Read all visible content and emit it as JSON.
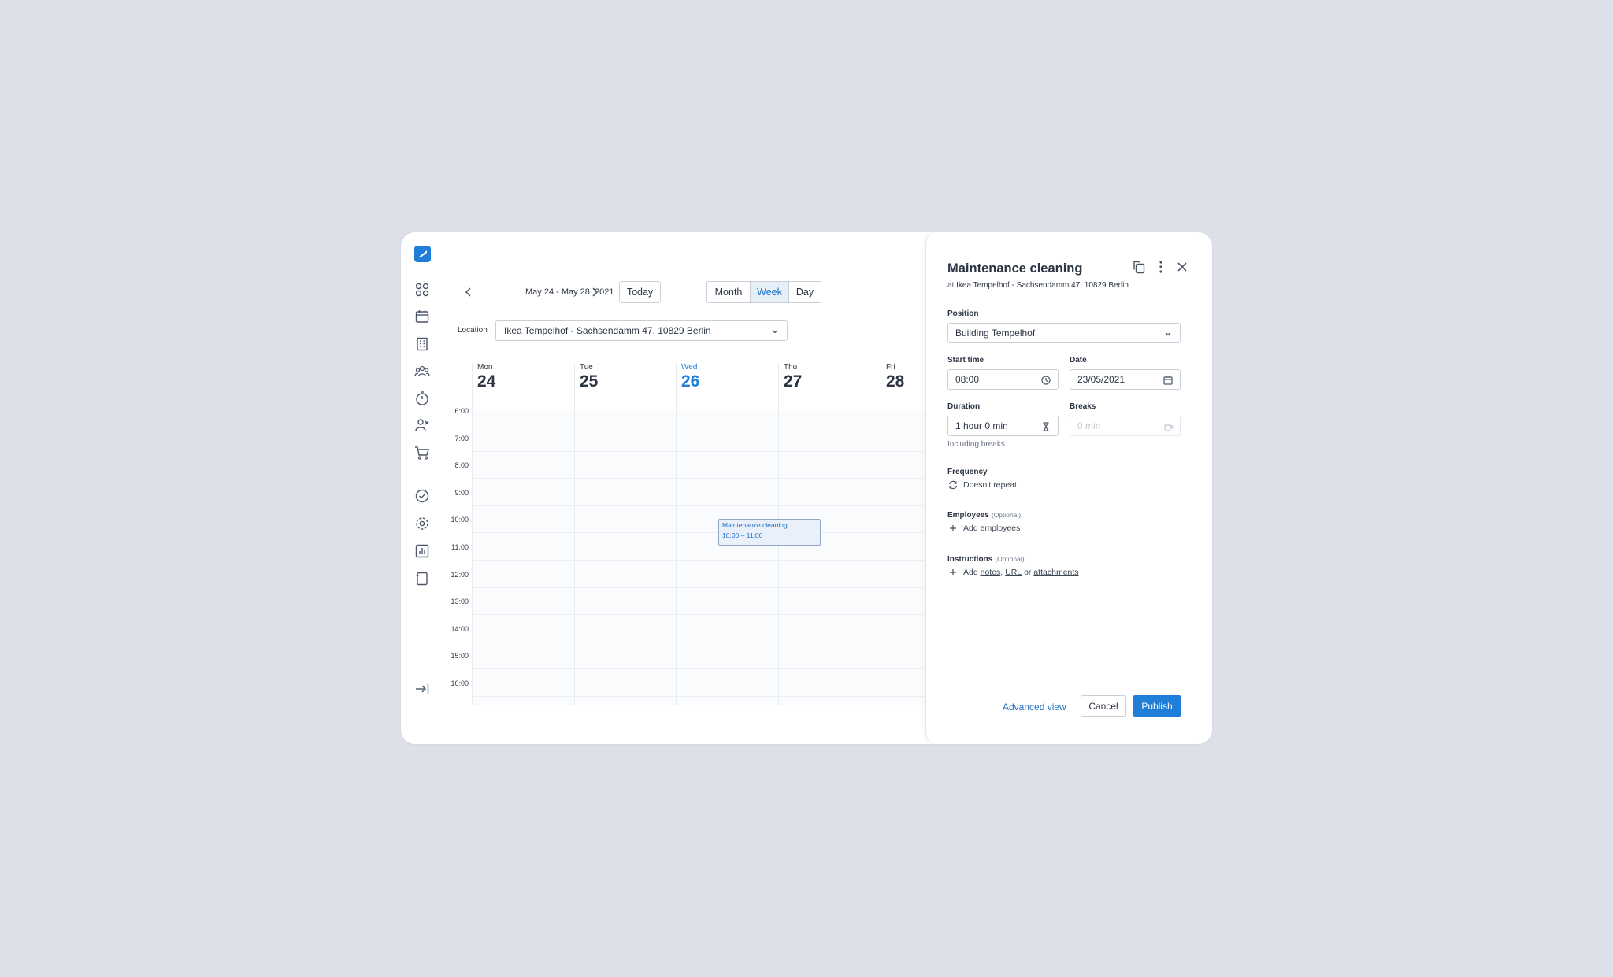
{
  "toolbar": {
    "date_range": "May 24 - May 28, 2021",
    "today_label": "Today",
    "views": [
      "Month",
      "Week",
      "Day"
    ],
    "active_view": "Week"
  },
  "location": {
    "label": "Location",
    "value": "Ikea Tempelhof - Sachsendamm 47, 10829 Berlin"
  },
  "days": [
    {
      "name": "Mon",
      "num": "24"
    },
    {
      "name": "Tue",
      "num": "25"
    },
    {
      "name": "Wed",
      "num": "26"
    },
    {
      "name": "Thu",
      "num": "27"
    },
    {
      "name": "Fri",
      "num": "28"
    }
  ],
  "hours": [
    "6:00",
    "7:00",
    "8:00",
    "9:00",
    "10:00",
    "11:00",
    "12:00",
    "13:00",
    "14:00",
    "15:00",
    "16:00"
  ],
  "event": {
    "title": "Maintenance cleaning",
    "time": "10:00 – 11:00"
  },
  "panel": {
    "title": "Maintenance cleaning",
    "subtitle_prefix": "at",
    "subtitle_location": "Ikea Tempelhof - Sachsendamm 47, 10829 Berlin",
    "position_label": "Position",
    "position_value": "Building Tempelhof",
    "start_time_label": "Start time",
    "start_time_value": "08:00",
    "date_label": "Date",
    "date_value": "23/05/2021",
    "duration_label": "Duration",
    "duration_value": "1 hour 0 min",
    "duration_hint": "Including breaks",
    "breaks_label": "Breaks",
    "breaks_value": "0 min",
    "frequency_label": "Frequency",
    "frequency_value": "Doesn't repeat",
    "employees_label": "Employees",
    "optional": "(Optional)",
    "add_employees": "Add employees",
    "instructions_label": "Instructions",
    "add_prefix": "Add",
    "notes": "notes",
    "url": "URL",
    "or": "or",
    "attachments": "attachments",
    "advanced_view": "Advanced view",
    "cancel": "Cancel",
    "publish": "Publish"
  },
  "colors": {
    "accent": "#1f7fd8",
    "background": "#dde0e8"
  }
}
